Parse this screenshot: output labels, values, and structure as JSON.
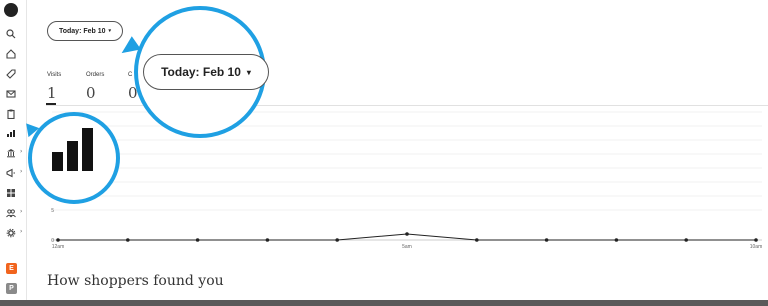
{
  "colors": {
    "accent": "#1fa0e3",
    "etsy_orange": "#f1641e",
    "badge_gray": "#8a8a8a",
    "chart_line": "#222222"
  },
  "sidebar": {
    "items": [
      {
        "icon": "search-icon"
      },
      {
        "icon": "home-icon"
      },
      {
        "icon": "tag-icon"
      },
      {
        "icon": "mail-icon"
      },
      {
        "icon": "clipboard-icon"
      },
      {
        "icon": "stats-bar-icon"
      },
      {
        "icon": "bank-icon"
      },
      {
        "icon": "megaphone-icon"
      },
      {
        "icon": "grid-icon"
      },
      {
        "icon": "people-icon"
      },
      {
        "icon": "gear-icon"
      }
    ],
    "badges": [
      {
        "letter": "E"
      },
      {
        "letter": "P"
      }
    ]
  },
  "date_filter": {
    "label": "Today: Feb 10",
    "caret": "▾"
  },
  "stats": [
    {
      "label": "Visits",
      "value": "1"
    },
    {
      "label": "Orders",
      "value": "0"
    },
    {
      "label": "C",
      "value": "0"
    }
  ],
  "zoom": {
    "pill_label": "Today: Feb 10",
    "caret": "▾",
    "bars_icon": "stats-bar-icon"
  },
  "chart_data": {
    "type": "line",
    "x": [
      "12am",
      "1am",
      "2am",
      "3am",
      "4am",
      "5am",
      "6am",
      "7am",
      "8am",
      "9am",
      "10am"
    ],
    "x_tick_labels_shown": [
      "12am",
      "5am",
      "10am"
    ],
    "series": [
      {
        "values": [
          0,
          0,
          0,
          0,
          0,
          1,
          0,
          0,
          0,
          0,
          0
        ]
      }
    ],
    "y_ticks": [
      "0",
      "5"
    ],
    "ylim": [
      0,
      5
    ],
    "grid": true
  },
  "section": {
    "heading": "How shoppers found you"
  }
}
